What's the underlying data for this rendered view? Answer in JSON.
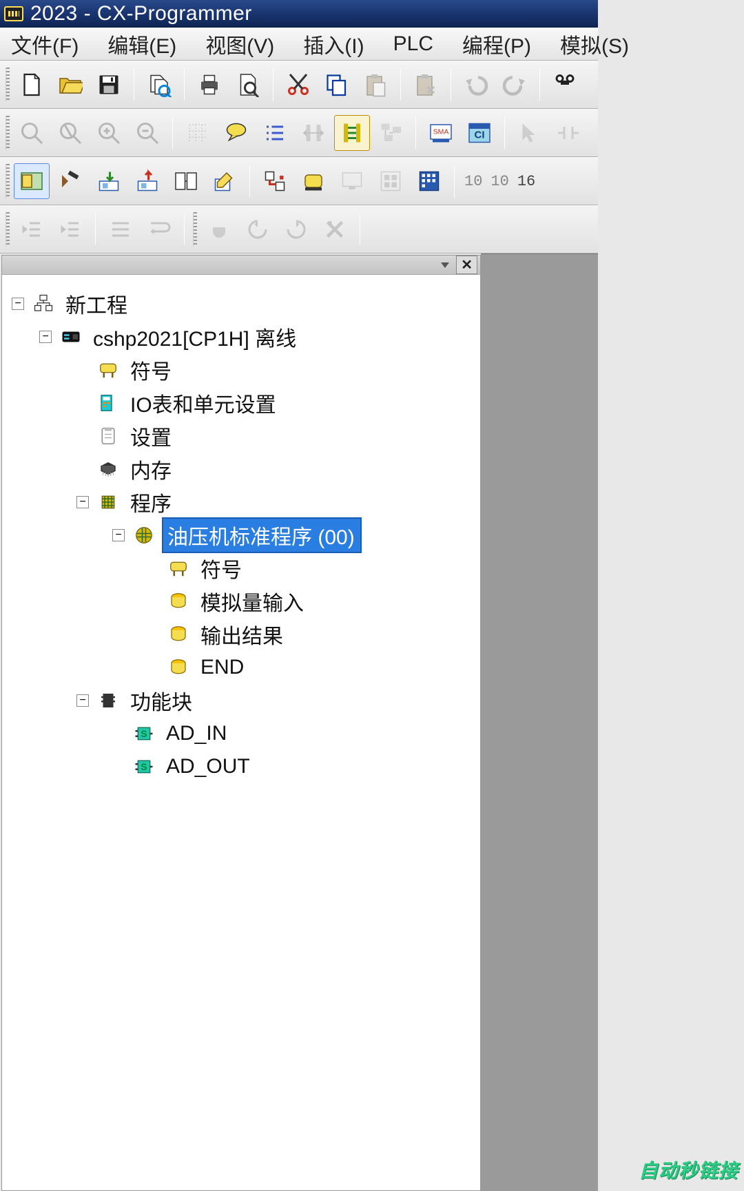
{
  "title": "2023 - CX-Programmer",
  "menu": {
    "file": "文件(F)",
    "edit": "编辑(E)",
    "view": "视图(V)",
    "insert": "插入(I)",
    "plc": "PLC",
    "program": "编程(P)",
    "simulate": "模拟(S)"
  },
  "toolbar1": {
    "new": "new",
    "open": "open",
    "save": "save",
    "compare": "compare",
    "print": "print",
    "preview": "preview",
    "cut": "cut",
    "copy": "copy",
    "paste": "paste",
    "pastespecial": "paste-special",
    "undo": "undo",
    "redo": "redo",
    "find": "find"
  },
  "toolbar3_labels": {
    "a": "10",
    "b": "10",
    "c": "16"
  },
  "tree": {
    "root": "新工程",
    "plc": "cshp2021[CP1H] 离线",
    "symbols": "符号",
    "iotable": "IO表和单元设置",
    "settings": "设置",
    "memory": "内存",
    "programs": "程序",
    "program1": "油压机标准程序 (00)",
    "prog_symbols": "符号",
    "section1": "模拟量输入",
    "section2": "输出结果",
    "section_end": "END",
    "fblocks": "功能块",
    "fb1": "AD_IN",
    "fb2": "AD_OUT"
  },
  "watermark": "自动秒链接"
}
